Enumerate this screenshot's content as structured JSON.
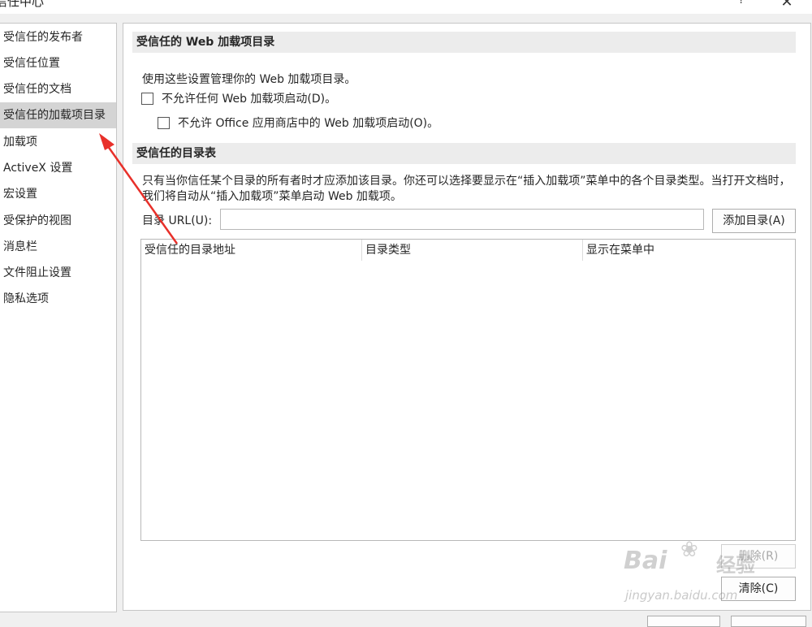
{
  "window": {
    "title": "信任中心",
    "help_glyph": "?",
    "close_glyph": "✕"
  },
  "sidebar": {
    "items": [
      {
        "label": "受信任的发布者"
      },
      {
        "label": "受信任位置"
      },
      {
        "label": "受信任的文档"
      },
      {
        "label": "受信任的加载项目录",
        "selected": true
      },
      {
        "label": "加载项"
      },
      {
        "label": "ActiveX 设置"
      },
      {
        "label": "宏设置"
      },
      {
        "label": "受保护的视图"
      },
      {
        "label": "消息栏"
      },
      {
        "label": "文件阻止设置"
      },
      {
        "label": "隐私选项"
      }
    ]
  },
  "section1": {
    "header": "受信任的 Web 加载项目录",
    "description": "使用这些设置管理你的 Web 加载项目录。",
    "checkbox1": {
      "label": "不允许任何 Web 加载项启动(D)。",
      "checked": false
    },
    "checkbox2": {
      "label": "不允许 Office 应用商店中的 Web 加载项启动(O)。",
      "checked": false
    }
  },
  "section2": {
    "header": "受信任的目录表",
    "description": "只有当你信任某个目录的所有者时才应添加该目录。你还可以选择要显示在“插入加载项”菜单中的各个目录类型。当打开文档时，我们将自动从“插入加载项”菜单启动 Web 加载项。",
    "url_label": "目录 URL(U):",
    "url_value": "",
    "add_button": "添加目录(A)",
    "table_columns": [
      "受信任的目录地址",
      "目录类型",
      "显示在菜单中"
    ],
    "delete_button": "删除(R)",
    "clear_button": "清除(C)"
  },
  "watermark": {
    "logo": "Bai",
    "paw": "❀",
    "logo_cn": "经验",
    "url": "jingyan.baidu.com"
  },
  "colors": {
    "selected_bg": "#d4d4d4",
    "arrow": "#e8302a"
  }
}
